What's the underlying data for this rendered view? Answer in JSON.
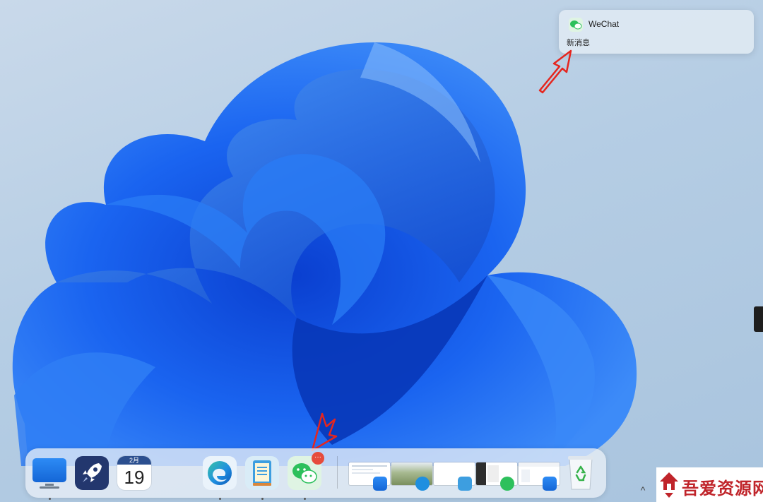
{
  "notification": {
    "app_name": "WeChat",
    "message": "新消息"
  },
  "dock": {
    "calendar": {
      "month": "2月",
      "day": "19"
    },
    "wechat_badge": "···",
    "running_windows": [
      "mail-window",
      "photo-window",
      "blank-window",
      "wechat-window",
      "explorer-window"
    ]
  },
  "watermark": {
    "text": "吾爱资源网"
  },
  "tray": {
    "chevron": "^"
  },
  "colors": {
    "accent_blue": "#1466d6",
    "annotation_red": "#e5261f",
    "badge_red": "#e64b3c",
    "wechat_green": "#2dc05c"
  },
  "icons": [
    "desktop-monitor-icon",
    "rocket-launcher-icon",
    "calendar-icon",
    "edge-browser-icon",
    "notes-icon",
    "wechat-icon",
    "recycle-bin-icon"
  ]
}
